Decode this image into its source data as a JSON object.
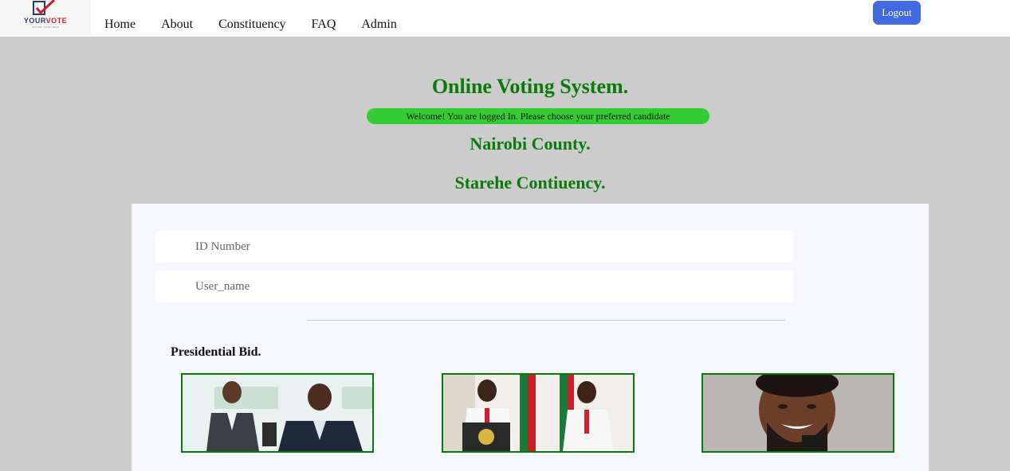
{
  "header": {
    "logo": {
      "brand_your": "YOUR",
      "brand_vote": "VOTE",
      "tagline": "ONLINE VOTE HERE"
    },
    "nav": [
      {
        "label": "Home"
      },
      {
        "label": "About"
      },
      {
        "label": "Constituency"
      },
      {
        "label": "FAQ"
      },
      {
        "label": "Admin"
      }
    ],
    "logout_label": "Logout"
  },
  "main": {
    "title": "Online Voting System.",
    "welcome": "Welcome! You are logged In. Please choose your preferred candidate",
    "county": "Nairobi County.",
    "constituency": "Starehe Contiuency."
  },
  "form": {
    "id_placeholder": "ID Number",
    "username_placeholder": "User_name",
    "section_label": "Presidential Bid."
  },
  "colors": {
    "accent_green": "#0a7a0a",
    "welcome_bg": "#33cc33",
    "logout_bg": "#4169e1",
    "page_bg": "#cccccc"
  }
}
